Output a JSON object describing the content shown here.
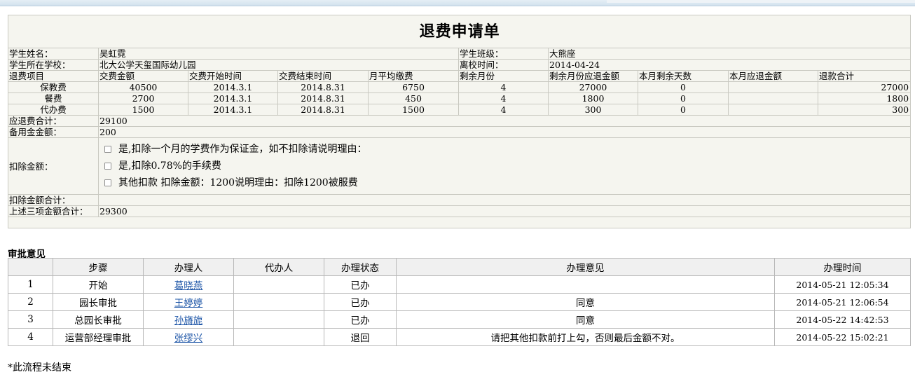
{
  "form": {
    "title": "退费申请单",
    "labels": {
      "student_name": "学生姓名：",
      "school": "学生所在学校：",
      "class": "学生班级：",
      "leave_date": "离校时间：",
      "refundable_total": "应退费合计：",
      "reserve_amount": "备用金金额：",
      "deduction": "扣除金额：",
      "deduction_total": "扣除金额合计：",
      "grand_total": "上述三项金额合计："
    },
    "student_name": "吴虹霓",
    "school": "北大公学天玺国际幼儿园",
    "class": "大熊座",
    "leave_date": "2014-04-24",
    "fee_headers": [
      "退费项目",
      "交费金额",
      "交费开始时间",
      "交费结束时间",
      "月平均缴费",
      "剩余月份",
      "剩余月份应退金额",
      "本月剩余天数",
      "本月应退金额",
      "退款合计"
    ],
    "fee_rows": [
      {
        "item": "保教费",
        "amount": "40500",
        "start": "2014.3.1",
        "end": "2014.8.31",
        "monthly": "6750",
        "months_left": "4",
        "months_refund": "27000",
        "days_left": "0",
        "month_refund": "",
        "total": "27000"
      },
      {
        "item": "餐费",
        "amount": "2700",
        "start": "2014.3.1",
        "end": "2014.8.31",
        "monthly": "450",
        "months_left": "4",
        "months_refund": "1800",
        "days_left": "0",
        "month_refund": "",
        "total": "1800"
      },
      {
        "item": "代办费",
        "amount": "1500",
        "start": "2014.3.1",
        "end": "2014.8.31",
        "monthly": "1500",
        "months_left": "4",
        "months_refund": "300",
        "days_left": "0",
        "month_refund": "",
        "total": "300"
      }
    ],
    "refundable_total": "29100",
    "reserve_amount": "200",
    "deduction_options": [
      {
        "label": "是,扣除一个月的学费作为保证金，如不扣除请说明理由：",
        "checked": false
      },
      {
        "label": "是,扣除0.78%的手续费",
        "checked": false
      },
      {
        "label": "其他扣款  扣除金额：1200说明理由：扣除1200被服费",
        "checked": false
      }
    ],
    "deduction_total": "",
    "grand_total": "29300"
  },
  "approval": {
    "section_title": "审批意见",
    "headers": [
      "",
      "步骤",
      "办理人",
      "代办人",
      "办理状态",
      "办理意见",
      "办理时间"
    ],
    "rows": [
      {
        "no": "1",
        "step": "开始",
        "handler": "葛晓燕",
        "proxy": "",
        "status": "已办",
        "opinion": "",
        "time": "2014-05-21 12:05:34"
      },
      {
        "no": "2",
        "step": "园长审批",
        "handler": "王婷婷",
        "proxy": "",
        "status": "已办",
        "opinion": "同意",
        "time": "2014-05-21 12:06:54"
      },
      {
        "no": "3",
        "step": "总园长审批",
        "handler": "孙旖旎",
        "proxy": "",
        "status": "已办",
        "opinion": "同意",
        "time": "2014-05-22 14:42:53"
      },
      {
        "no": "4",
        "step": "运营部经理审批",
        "handler": "张缪兴",
        "proxy": "",
        "status": "退回",
        "opinion": "请把其他扣款前打上勾，否则最后金额不对。",
        "time": "2014-05-22 15:02:21"
      }
    ]
  },
  "footer_note": "*此流程未结束"
}
